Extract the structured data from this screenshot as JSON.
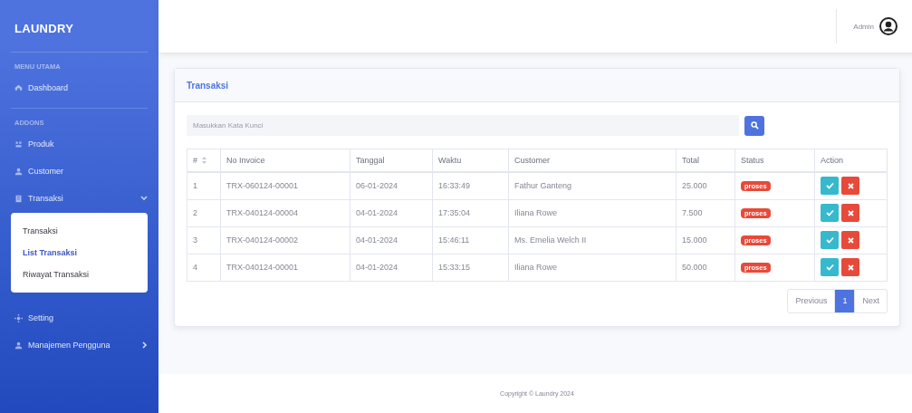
{
  "sidebar": {
    "brand": "LAUNDRY",
    "sections": [
      {
        "heading": "MENU UTAMA",
        "items": [
          {
            "label": "Dashboard",
            "kind": "link"
          }
        ]
      },
      {
        "heading": "ADDONS",
        "items": [
          {
            "label": "Produk",
            "kind": "link"
          },
          {
            "label": "Customer",
            "kind": "link"
          },
          {
            "label": "Transaksi",
            "kind": "dropdown",
            "expanded": true,
            "children": [
              {
                "label": "Transaksi",
                "selected": false
              },
              {
                "label": "List Transaksi",
                "selected": true
              },
              {
                "label": "Riwayat Transaksi",
                "selected": false
              }
            ]
          },
          {
            "label": "Setting",
            "kind": "link"
          },
          {
            "label": "Manajemen Pengguna",
            "kind": "dropdown",
            "expanded": false
          }
        ]
      }
    ]
  },
  "topbar": {
    "user": "Admin"
  },
  "card": {
    "title": "Transaksi",
    "search": {
      "placeholder": "Masukkan Kata Kunci"
    },
    "table": {
      "columns": [
        "#",
        "No Invoice",
        "Tanggal",
        "Waktu",
        "Customer",
        "Total",
        "Status",
        "Action"
      ],
      "rows": [
        {
          "cells": [
            "1",
            "TRX-060124-00001",
            "06-01-2024",
            "16:33:49",
            "Fathur Ganteng",
            "25.000"
          ],
          "status": "proses"
        },
        {
          "cells": [
            "2",
            "TRX-040124-00004",
            "04-01-2024",
            "17:35:04",
            "Iliana Rowe",
            "7.500"
          ],
          "status": "proses"
        },
        {
          "cells": [
            "3",
            "TRX-040124-00002",
            "04-01-2024",
            "15:46:11",
            "Ms. Emelia Welch II",
            "15.000"
          ],
          "status": "proses"
        },
        {
          "cells": [
            "4",
            "TRX-040124-00001",
            "04-01-2024",
            "15:33:15",
            "Iliana Rowe",
            "50.000"
          ],
          "status": "proses"
        }
      ]
    },
    "pagination": {
      "previous": "Previous",
      "pages": [
        {
          "label": "1",
          "selected": true
        }
      ],
      "next": "Next"
    }
  },
  "footer": "Copyright © Laundry 2024"
}
